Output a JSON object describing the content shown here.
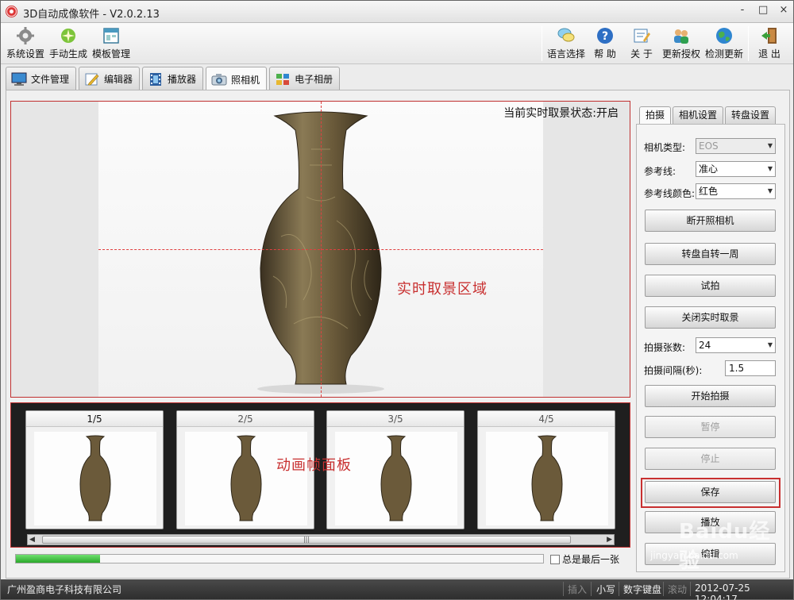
{
  "window": {
    "title": "3D自动成像软件 - V2.0.2.13",
    "controls": [
      "-",
      "□",
      "×"
    ]
  },
  "toolbar": {
    "left": [
      {
        "label": "系统设置",
        "icon": "gear-icon"
      },
      {
        "label": "手动生成",
        "icon": "sparkle-icon"
      },
      {
        "label": "模板管理",
        "icon": "template-icon"
      }
    ],
    "right": [
      {
        "label": "语言选择",
        "icon": "speech-bubble-icon"
      },
      {
        "label": "帮 助",
        "icon": "help-icon"
      },
      {
        "label": "关 于",
        "icon": "about-icon"
      },
      {
        "label": "更新授权",
        "icon": "users-icon"
      },
      {
        "label": "检测更新",
        "icon": "globe-icon"
      },
      {
        "label": "退 出",
        "icon": "exit-door-icon"
      }
    ]
  },
  "tabs": [
    {
      "label": "文件管理",
      "icon": "monitor-icon"
    },
    {
      "label": "编辑器",
      "icon": "pencil-icon"
    },
    {
      "label": "播放器",
      "icon": "film-icon"
    },
    {
      "label": "照相机",
      "icon": "camera-icon",
      "active": true
    },
    {
      "label": "电子相册",
      "icon": "album-icon"
    }
  ],
  "live_view": {
    "status": "当前实时取景状态:开启",
    "area_label": "实时取景区域"
  },
  "frames": {
    "panel_label": "动画帧面板",
    "items": [
      "1/5",
      "2/5",
      "3/5",
      "4/5"
    ],
    "current": "1/5",
    "scroll_grip": "|||"
  },
  "progress": {
    "value": 0.16
  },
  "last_frame_checkbox": {
    "label": "总是最后一张",
    "checked": false
  },
  "right_panel": {
    "tabs": [
      "拍摄",
      "相机设置",
      "转盘设置"
    ],
    "active_tab": "拍摄",
    "camera_type": {
      "label": "相机类型:",
      "value": "EOS"
    },
    "guide_line": {
      "label": "参考线:",
      "value": "准心"
    },
    "guide_color": {
      "label": "参考线颜色:",
      "value": "红色"
    },
    "buttons": {
      "disconnect": "断开照相机",
      "rotate_once": "转盘自转一周",
      "test_shot": "试拍",
      "close_live": "关闭实时取景",
      "start": "开始拍摄",
      "pause": "暂停",
      "stop": "停止",
      "save": "保存",
      "play": "播放",
      "edit": "编辑"
    },
    "shot_count": {
      "label": "拍摄张数:",
      "value": "24"
    },
    "interval": {
      "label": "拍摄间隔(秒):",
      "value": "1.5"
    }
  },
  "statusbar": {
    "company": "广州盈商电子科技有限公司",
    "insert": "插入",
    "case": "小写",
    "numpad": "数字键盘",
    "scroll": "滚动",
    "datetime": "2012-07-25 12:04:17"
  },
  "watermark": {
    "brand": "Baidu经验",
    "url": "jingyan.baidu.com"
  },
  "colors": {
    "annotation_red": "#c83030",
    "progress_green": "#2aa82a",
    "statusbar_bg": "#3a3a3a"
  }
}
